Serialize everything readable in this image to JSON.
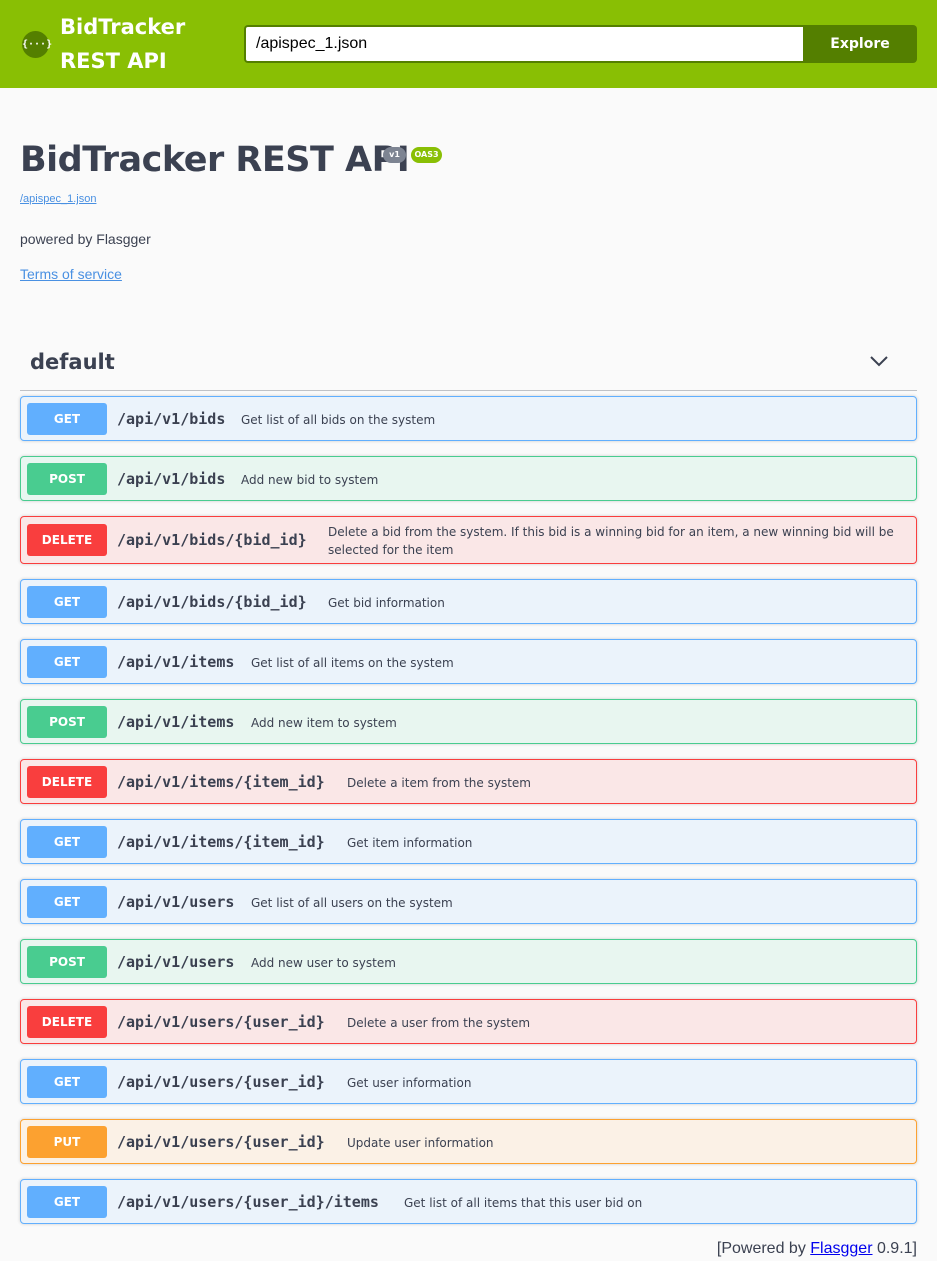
{
  "topbar": {
    "logo_glyph": "{···}",
    "brand": "BidTracker REST API",
    "spec_url": "/apispec_1.json",
    "explore_label": "Explore"
  },
  "info": {
    "title": "BidTracker REST API",
    "version_badge": "v1",
    "oas_badge": "OAS3",
    "spec_link": "/apispec_1.json",
    "description": "powered by Flasgger",
    "terms_label": "Terms of service"
  },
  "section": {
    "name": "default",
    "chevron": "chevron-down-icon"
  },
  "operations": [
    {
      "method": "GET",
      "path": "/api/v1/bids",
      "summary": "Get list of all bids on the system"
    },
    {
      "method": "POST",
      "path": "/api/v1/bids",
      "summary": "Add new bid to system"
    },
    {
      "method": "DELETE",
      "path": "/api/v1/bids/{bid_id}",
      "summary": "Delete a bid from the system. If this bid is a winning bid for an item, a new winning bid will be selected for the item"
    },
    {
      "method": "GET",
      "path": "/api/v1/bids/{bid_id}",
      "summary": "Get bid information"
    },
    {
      "method": "GET",
      "path": "/api/v1/items",
      "summary": "Get list of all items on the system"
    },
    {
      "method": "POST",
      "path": "/api/v1/items",
      "summary": "Add new item to system"
    },
    {
      "method": "DELETE",
      "path": "/api/v1/items/{item_id}",
      "summary": "Delete a item from the system"
    },
    {
      "method": "GET",
      "path": "/api/v1/items/{item_id}",
      "summary": "Get item information"
    },
    {
      "method": "GET",
      "path": "/api/v1/users",
      "summary": "Get list of all users on the system"
    },
    {
      "method": "POST",
      "path": "/api/v1/users",
      "summary": "Add new user to system"
    },
    {
      "method": "DELETE",
      "path": "/api/v1/users/{user_id}",
      "summary": "Delete a user from the system"
    },
    {
      "method": "GET",
      "path": "/api/v1/users/{user_id}",
      "summary": "Get user information"
    },
    {
      "method": "PUT",
      "path": "/api/v1/users/{user_id}",
      "summary": "Update user information"
    },
    {
      "method": "GET",
      "path": "/api/v1/users/{user_id}/items",
      "summary": "Get list of all items that this user bid on"
    }
  ],
  "colors": {
    "topbar": "#89bf04",
    "get": "#61affe",
    "post": "#49cc90",
    "delete": "#f93e3e",
    "put": "#fca130"
  },
  "footer": {
    "prefix": "[Powered by ",
    "link": "Flasgger",
    "suffix": " 0.9.1]"
  }
}
